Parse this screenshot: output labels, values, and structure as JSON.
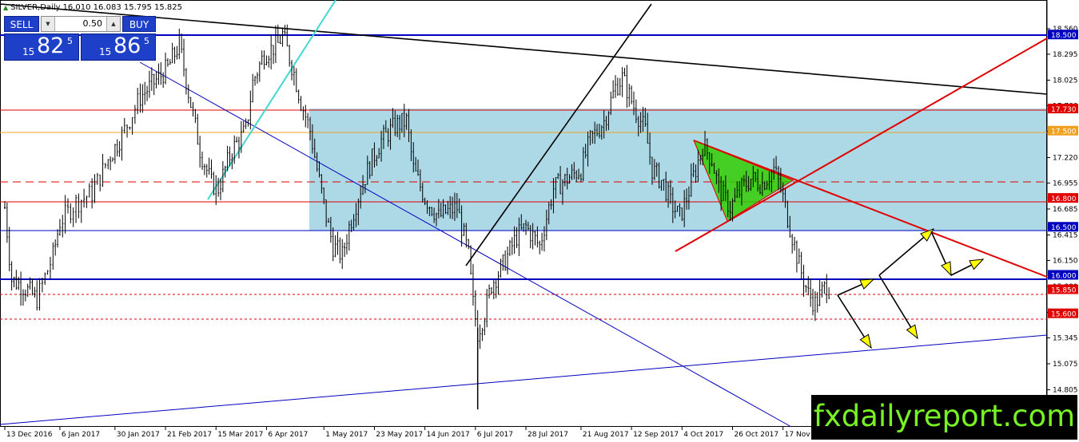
{
  "symbol": {
    "title": "SILVER,Daily",
    "ohlc": "16.010 16.083 15.795 15.825"
  },
  "trade_panel": {
    "sell_label": "SELL",
    "buy_label": "BUY",
    "lot_value": "0.50",
    "sell_quote": {
      "prefix": "15",
      "big": "82",
      "sup": "5"
    },
    "buy_quote": {
      "prefix": "15",
      "big": "86",
      "sup": "5"
    }
  },
  "watermark": "fxdailyreport.com",
  "colors": {
    "background": "#ffffff",
    "candles": "#000000",
    "trade_button": "#1e3fc8",
    "range_box": "#add8e6",
    "support_resistance_red": "#e00000",
    "level_orange": "#f0a020",
    "channel_blue": "#0000c0",
    "triangle_fill": "#33cc00",
    "arrow_fill": "#ffff00",
    "watermark_bg": "#000000",
    "watermark_text": "#77f222"
  },
  "chart_data": {
    "type": "candlestick",
    "symbol": "SILVER",
    "timeframe": "Daily",
    "ylim": [
      14.8,
      18.65
    ],
    "yticks": [
      "18.560",
      "18.295",
      "18.025",
      "17.760",
      "17.490",
      "17.220",
      "16.955",
      "16.685",
      "16.415",
      "16.150",
      "15.880",
      "15.610",
      "15.345",
      "15.075",
      "14.805"
    ],
    "xticks": [
      "13 Dec 2016",
      "6 Jan 2017",
      "30 Jan 2017",
      "21 Feb 2017",
      "15 Mar 2017",
      "6 Apr 2017",
      "1 May 2017",
      "23 May 2017",
      "14 Jun 2017",
      "6 Jul 2017",
      "28 Jul 2017",
      "21 Aug 2017",
      "12 Sep 2017",
      "4 Oct 2017",
      "26 Oct 2017",
      "17 Nov 2017"
    ],
    "price_levels": [
      {
        "label": "18.500",
        "value": 18.5,
        "style": "solid-blue"
      },
      {
        "label": "17.730",
        "value": 17.73,
        "style": "solid-red"
      },
      {
        "label": "17.500",
        "value": 17.5,
        "style": "solid-orange"
      },
      {
        "label": "16.950",
        "value": 16.95,
        "style": "dashed-red"
      },
      {
        "label": "16.800",
        "value": 16.8,
        "style": "solid-red"
      },
      {
        "label": "16.500",
        "value": 16.5,
        "style": "solid-blue"
      },
      {
        "label": "16.000",
        "value": 16.0,
        "style": "solid-blue"
      },
      {
        "label": "15.850",
        "value": 15.85,
        "style": "dotted-red"
      },
      {
        "label": "15.600",
        "value": 15.6,
        "style": "dotted-red"
      }
    ],
    "range_zone": {
      "from_date": "1 May 2017",
      "to_date": "right edge",
      "low": 16.5,
      "high": 17.73
    },
    "pattern": "symmetrical triangle (Oct–Nov 2017)",
    "close_path": [
      {
        "date": "13 Dec 2016",
        "close": 16.7
      },
      {
        "date": "16 Dec 2016",
        "close": 15.95
      },
      {
        "date": "21 Dec 2016",
        "close": 15.88
      },
      {
        "date": "27 Dec 2016",
        "close": 15.75
      },
      {
        "date": "3 Jan 2017",
        "close": 16.2
      },
      {
        "date": "6 Jan 2017",
        "close": 16.55
      },
      {
        "date": "13 Jan 2017",
        "close": 16.75
      },
      {
        "date": "20 Jan 2017",
        "close": 16.85
      },
      {
        "date": "27 Jan 2017",
        "close": 17.2
      },
      {
        "date": "2 Feb 2017",
        "close": 17.45
      },
      {
        "date": "10 Feb 2017",
        "close": 17.85
      },
      {
        "date": "16 Feb 2017",
        "close": 18.0
      },
      {
        "date": "22 Feb 2017",
        "close": 18.15
      },
      {
        "date": "27 Feb 2017",
        "close": 18.4
      },
      {
        "date": "3 Mar 2017",
        "close": 17.9
      },
      {
        "date": "8 Mar 2017",
        "close": 17.3
      },
      {
        "date": "13 Mar 2017",
        "close": 16.95
      },
      {
        "date": "16 Mar 2017",
        "close": 16.9
      },
      {
        "date": "22 Mar 2017",
        "close": 17.3
      },
      {
        "date": "28 Mar 2017",
        "close": 17.5
      },
      {
        "date": "31 Mar 2017",
        "close": 18.0
      },
      {
        "date": "5 Apr 2017",
        "close": 18.3
      },
      {
        "date": "11 Apr 2017",
        "close": 18.4
      },
      {
        "date": "13 Apr 2017",
        "close": 18.5
      },
      {
        "date": "18 Apr 2017",
        "close": 18.1
      },
      {
        "date": "21 Apr 2017",
        "close": 17.8
      },
      {
        "date": "25 Apr 2017",
        "close": 17.5
      },
      {
        "date": "28 Apr 2017",
        "close": 17.1
      },
      {
        "date": "2 May 2017",
        "close": 16.6
      },
      {
        "date": "5 May 2017",
        "close": 16.3
      },
      {
        "date": "9 May 2017",
        "close": 16.2
      },
      {
        "date": "12 May 2017",
        "close": 16.5
      },
      {
        "date": "17 May 2017",
        "close": 16.9
      },
      {
        "date": "22 May 2017",
        "close": 17.2
      },
      {
        "date": "26 May 2017",
        "close": 17.4
      },
      {
        "date": "1 Jun 2017",
        "close": 17.55
      },
      {
        "date": "6 Jun 2017",
        "close": 17.6
      },
      {
        "date": "9 Jun 2017",
        "close": 17.1
      },
      {
        "date": "14 Jun 2017",
        "close": 16.8
      },
      {
        "date": "20 Jun 2017",
        "close": 16.6
      },
      {
        "date": "23 Jun 2017",
        "close": 16.65
      },
      {
        "date": "28 Jun 2017",
        "close": 16.7
      },
      {
        "date": "3 Jul 2017",
        "close": 16.2
      },
      {
        "date": "5 Jul 2017",
        "close": 15.7
      },
      {
        "date": "7 Jul 2017",
        "close": 15.4
      },
      {
        "date": "10 Jul 2017",
        "close": 15.6
      },
      {
        "date": "13 Jul 2017",
        "close": 15.9
      },
      {
        "date": "18 Jul 2017",
        "close": 16.1
      },
      {
        "date": "24 Jul 2017",
        "close": 16.4
      },
      {
        "date": "28 Jul 2017",
        "close": 16.5
      },
      {
        "date": "3 Aug 2017",
        "close": 16.3
      },
      {
        "date": "9 Aug 2017",
        "close": 16.9
      },
      {
        "date": "15 Aug 2017",
        "close": 17.0
      },
      {
        "date": "21 Aug 2017",
        "close": 17.1
      },
      {
        "date": "25 Aug 2017",
        "close": 17.4
      },
      {
        "date": "31 Aug 2017",
        "close": 17.6
      },
      {
        "date": "5 Sep 2017",
        "close": 17.95
      },
      {
        "date": "8 Sep 2017",
        "close": 18.05
      },
      {
        "date": "13 Sep 2017",
        "close": 17.75
      },
      {
        "date": "18 Sep 2017",
        "close": 17.5
      },
      {
        "date": "21 Sep 2017",
        "close": 17.1
      },
      {
        "date": "26 Sep 2017",
        "close": 16.95
      },
      {
        "date": "29 Sep 2017",
        "close": 16.75
      },
      {
        "date": "3 Oct 2017",
        "close": 16.6
      },
      {
        "date": "6 Oct 2017",
        "close": 16.8
      },
      {
        "date": "10 Oct 2017",
        "close": 17.1
      },
      {
        "date": "13 Oct 2017",
        "close": 17.35
      },
      {
        "date": "17 Oct 2017",
        "close": 17.2
      },
      {
        "date": "20 Oct 2017",
        "close": 16.9
      },
      {
        "date": "25 Oct 2017",
        "close": 16.7
      },
      {
        "date": "30 Oct 2017",
        "close": 16.9
      },
      {
        "date": "3 Nov 2017",
        "close": 17.0
      },
      {
        "date": "8 Nov 2017",
        "close": 16.95
      },
      {
        "date": "13 Nov 2017",
        "close": 17.1
      },
      {
        "date": "16 Nov 2017",
        "close": 16.9
      },
      {
        "date": "21 Nov 2017",
        "close": 16.4
      },
      {
        "date": "24 Nov 2017",
        "close": 16.1
      },
      {
        "date": "28 Nov 2017",
        "close": 15.8
      },
      {
        "date": "1 Dec 2017",
        "close": 15.7
      },
      {
        "date": "6 Dec 2017",
        "close": 15.9
      },
      {
        "date": "8 Dec 2017",
        "close": 15.825
      }
    ]
  }
}
